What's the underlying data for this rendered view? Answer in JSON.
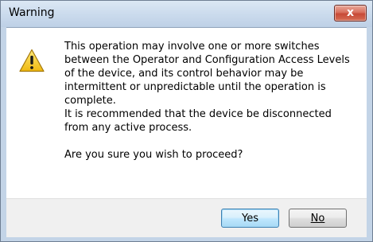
{
  "dialog": {
    "title": "Warning",
    "close_label": "x",
    "icon": "warning-icon",
    "message_lines": [
      "This operation may involve one or more switches",
      "between the Operator and Configuration Access Levels",
      "of the device, and its control behavior may be",
      "intermittent or unpredictable until the operation is",
      "complete.",
      "It is recommended that the device be disconnected",
      "from any active process.",
      "",
      "Are you sure you wish to proceed?"
    ],
    "buttons": {
      "yes_label": "Yes",
      "no_label": "No"
    }
  },
  "colors": {
    "close_button": "#c74a36",
    "icon_yellow": "#f2c21b",
    "default_button_border": "#3c7fb1"
  }
}
